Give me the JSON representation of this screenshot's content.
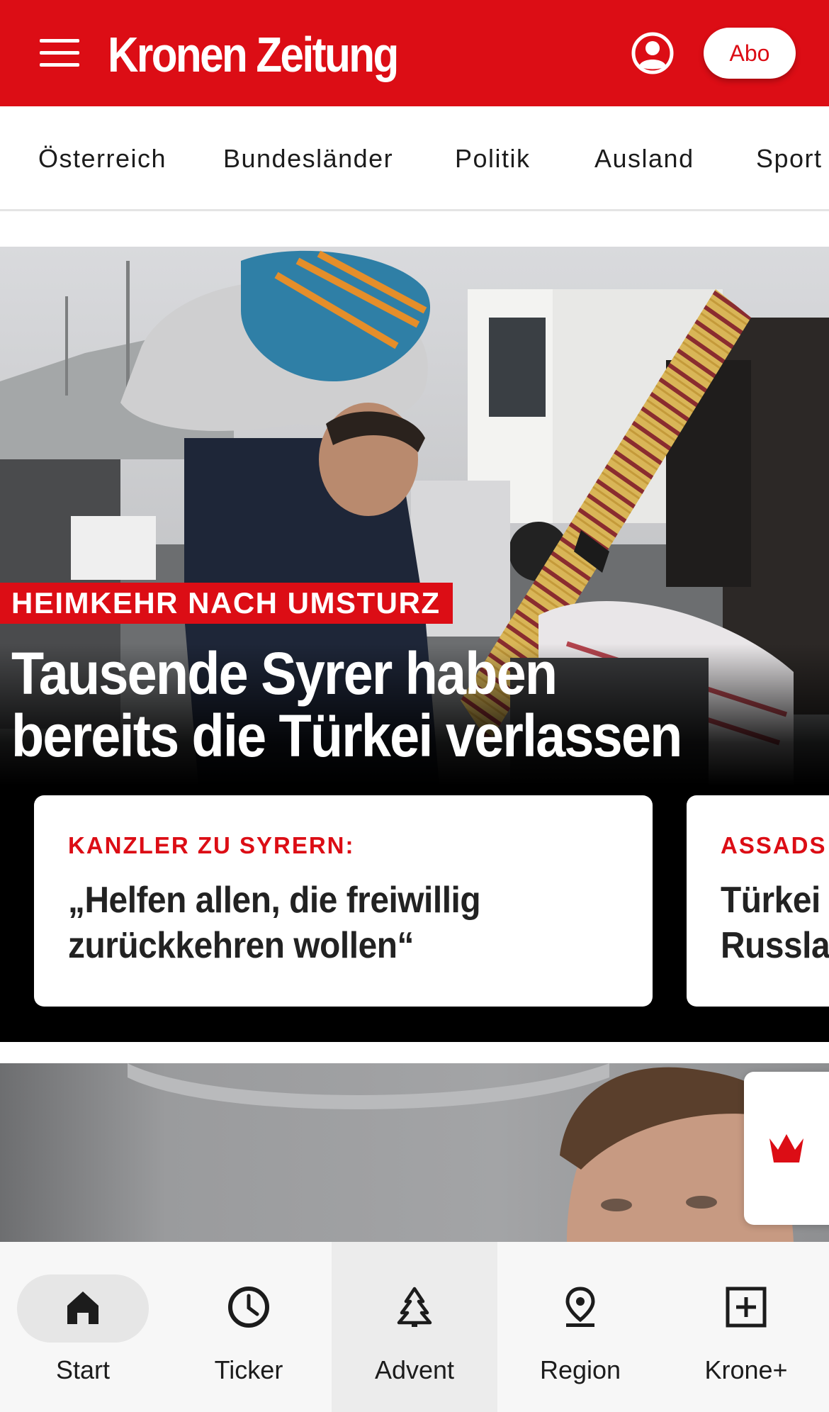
{
  "header": {
    "logo_text": "Kronen Zeitung",
    "abo_label": "Abo",
    "accent_color": "#dc0d15",
    "icons": [
      "menu-icon",
      "account-icon"
    ]
  },
  "categories": [
    "Österreich",
    "Bundesländer",
    "Politik",
    "Ausland",
    "Sport"
  ],
  "hero": {
    "kicker": "HEIMKEHR NACH UMSTURZ",
    "title": "Tausende Syrer haben bereits die Türkei verlassen",
    "teasers": [
      {
        "kicker": "KANZLER ZU SYRERN:",
        "title": "„Helfen allen, die freiwillig\nzurückkehren wollen“"
      },
      {
        "kicker": "ASSADS",
        "title": "Türkei\nRussla"
      }
    ]
  },
  "krone_plus_icon": "crown-icon",
  "bottom_nav": [
    {
      "label": "Start",
      "icon": "home-icon",
      "active": true
    },
    {
      "label": "Ticker",
      "icon": "clock-icon",
      "active": false
    },
    {
      "label": "Advent",
      "icon": "tree-icon",
      "active": false
    },
    {
      "label": "Region",
      "icon": "location-pin-icon",
      "active": false
    },
    {
      "label": "Krone+",
      "icon": "plus-box-icon",
      "active": false
    }
  ]
}
